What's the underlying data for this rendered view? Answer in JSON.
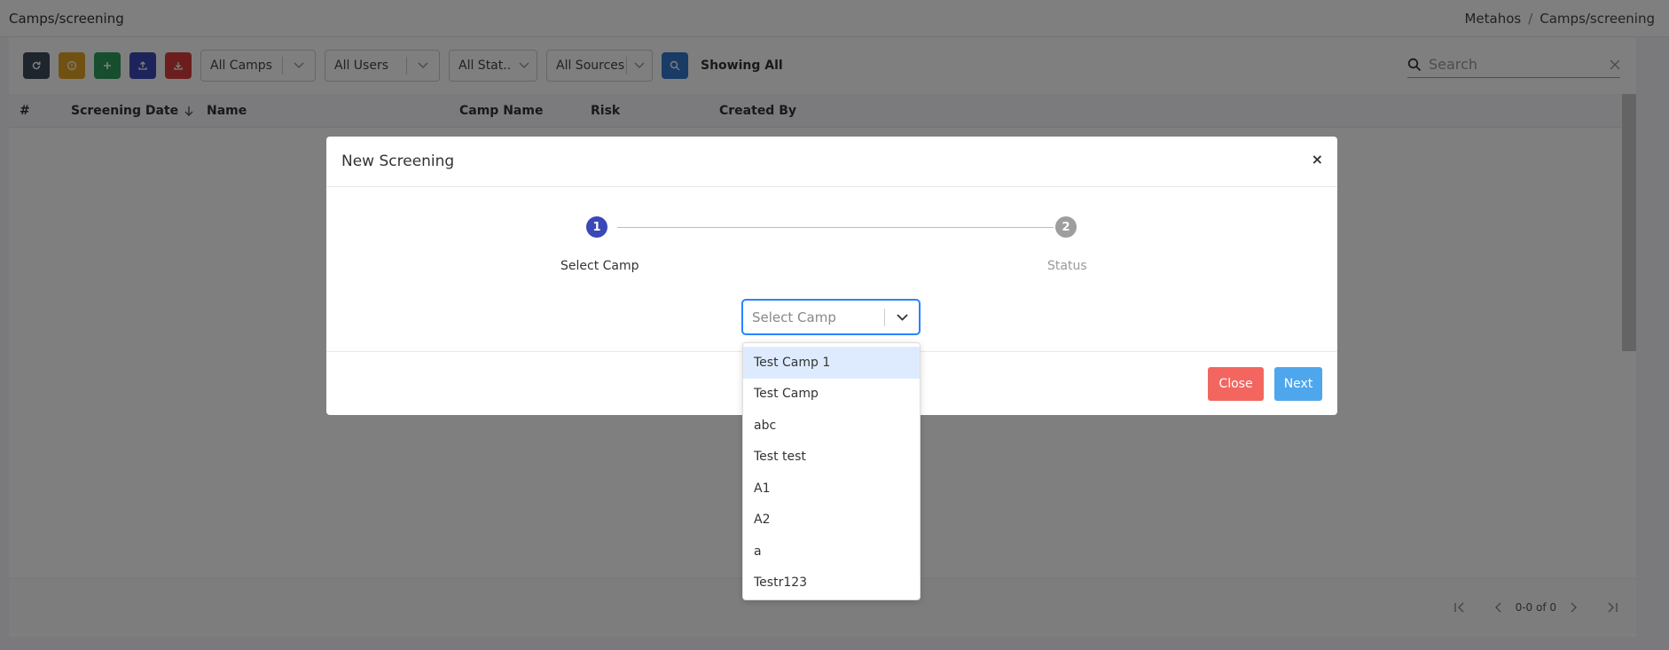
{
  "header": {
    "page_title": "Camps/screening",
    "breadcrumb": [
      "Metahos",
      "/",
      "Camps/screening"
    ]
  },
  "toolbar": {
    "buttons": [
      "refresh-icon",
      "warning-icon",
      "plus-icon",
      "upload-icon",
      "download-icon"
    ],
    "filters": [
      "All Camps",
      "All Users",
      "All Stat...",
      "All Sources"
    ],
    "showing_label": "Showing All",
    "search_placeholder": "Search"
  },
  "table": {
    "columns": [
      "#",
      "Screening Date",
      "Name",
      "Camp Name",
      "Risk",
      "Created By"
    ],
    "rows": []
  },
  "pagination": {
    "range": "0-0 of 0"
  },
  "modal": {
    "title": "New Screening",
    "close_glyph": "×",
    "steps": [
      {
        "number": "1",
        "label": "Select Camp",
        "active": true
      },
      {
        "number": "2",
        "label": "Status",
        "active": false
      }
    ],
    "select_placeholder": "Select Camp",
    "close_button": "Close",
    "next_button": "Next"
  },
  "camp_options": [
    "Test Camp 1",
    "Test Camp",
    "abc",
    "Test test",
    "A1",
    "A2",
    "a",
    "Testr123"
  ],
  "colors": {
    "step_active": "#3b48b8",
    "step_inactive": "#9e9e9e",
    "close_button": "#f2665f",
    "next_button": "#4ea6ec",
    "select_focus": "#2684ff",
    "option_highlight": "#deebff"
  }
}
